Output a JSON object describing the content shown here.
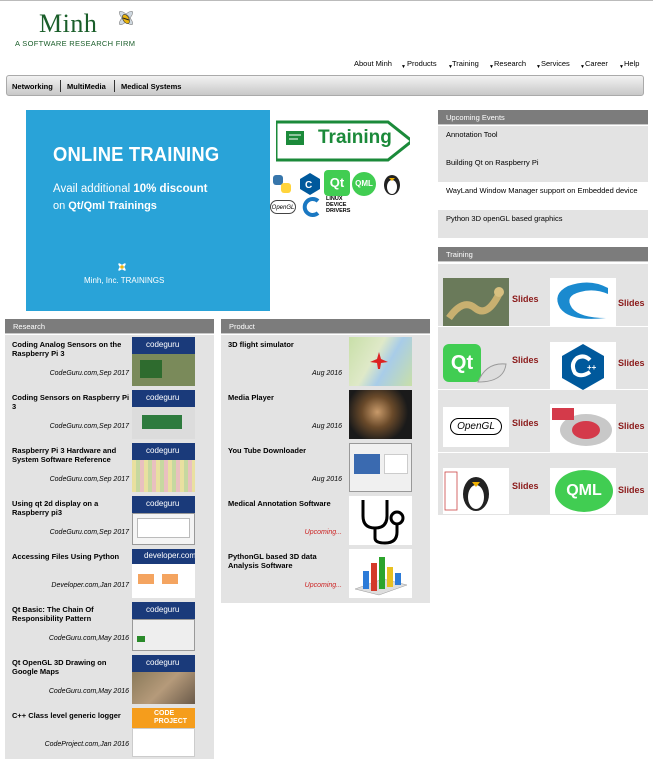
{
  "logo": {
    "name": "Minh",
    "tagline": "A SOFTWARE RESEARCH FIRM"
  },
  "topnav": [
    "About Minh",
    "Products",
    "Training",
    "Research",
    "Services",
    "Career",
    "Help"
  ],
  "subnav": [
    "Networking",
    "MultiMedia",
    "Medical Systems"
  ],
  "banner": {
    "title": "ONLINE TRAINING",
    "line1_a": "Avail additional ",
    "line1_b": "10% discount",
    "line2_a": "on ",
    "line2_b": "Qt/Qml Trainings",
    "footer": "Minh, Inc. TRAININGS",
    "arrow_text": "Training",
    "linux_label": "LINUX DEVICE DRIVERS",
    "opengl_label": "OpenGL",
    "qt_label": "Qt",
    "qml_label": "QML"
  },
  "research": {
    "header": "Research",
    "thumb_label": "codeguru",
    "items": [
      {
        "title": "Coding Analog Sensors on the Raspberry Pi 3",
        "source": "CodeGuru.com,Sep 2017"
      },
      {
        "title": "Coding Sensors on Raspberry Pi 3",
        "source": "CodeGuru.com,Sep 2017"
      },
      {
        "title": "Raspberry Pi 3 Hardware and System Software Reference",
        "source": "CodeGuru.com,Sep 2017"
      },
      {
        "title": "Using qt 2d display on a Raspberry pi3",
        "source": "CodeGuru.com,Sep 2017"
      },
      {
        "title": "Accessing Files Using Python",
        "source": "Developer.com,Jan 2017"
      },
      {
        "title": "Qt Basic: The Chain Of Responsibility Pattern",
        "source": "CodeGuru.com,May 2016"
      },
      {
        "title": "Qt OpenGL 3D Drawing on Google Maps",
        "source": "CodeGuru.com,May 2016"
      },
      {
        "title": "C++ Class level generic logger",
        "source": "CodeProject.com,Jan 2016"
      }
    ],
    "developer_label": "developer.com",
    "codeproject_label": "CODE PROJECT"
  },
  "product": {
    "header": "Product",
    "items": [
      {
        "title": "3D flight simulator",
        "date": "Aug 2016"
      },
      {
        "title": "Media Player",
        "date": "Aug 2016"
      },
      {
        "title": "You Tube Downloader",
        "date": "Aug 2016"
      },
      {
        "title": "Medical Annotation Software",
        "date": "Upcoming..."
      },
      {
        "title": "PythonGL based 3D data Analysis Software",
        "date": "Upcoming..."
      }
    ]
  },
  "events": {
    "header": "Upcoming Events",
    "items": [
      "Annotation Tool",
      "Building Qt on Raspberry Pi",
      "WayLand Window Manager support on Embedded device",
      "Python 3D openGL based graphics"
    ]
  },
  "training": {
    "header": "Training",
    "slides_label": "Slides",
    "qt_label": "Qt",
    "opengl_label": "OpenGL",
    "qml_label": "QML"
  },
  "colors": {
    "brand_green": "#1a5e2a",
    "banner_blue": "#29a3d8",
    "header_gray": "#7c7c7c",
    "slides_red": "#8b1a1a",
    "upcoming_red": "#cc2222"
  }
}
